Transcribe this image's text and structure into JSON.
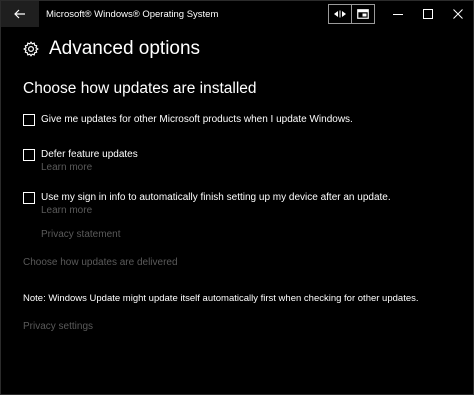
{
  "window": {
    "title": "Microsoft® Windows® Operating System",
    "controls": {
      "minimize": "—",
      "maximize": "☐",
      "close": "✕"
    }
  },
  "header": {
    "title": "Advanced options",
    "icon": "gear-icon"
  },
  "section": {
    "title": "Choose how updates are installed"
  },
  "options": [
    {
      "label": "Give me updates for other Microsoft products when I update Windows.",
      "checked": false
    },
    {
      "label": "Defer feature updates",
      "checked": false,
      "link": "Learn more"
    },
    {
      "label": "Use my sign in info to automatically finish setting up my device after an update.",
      "checked": false,
      "link": "Learn more"
    }
  ],
  "links": {
    "privacy_statement": "Privacy statement",
    "delivery": "Choose how updates are delivered",
    "privacy_settings": "Privacy settings"
  },
  "note": "Note: Windows Update might update itself automatically first when checking for other updates.",
  "colors": {
    "background": "#000000",
    "text": "#ffffff",
    "disabled_text": "#5a5a5a",
    "back_button_bg": "#1f1f1f"
  }
}
